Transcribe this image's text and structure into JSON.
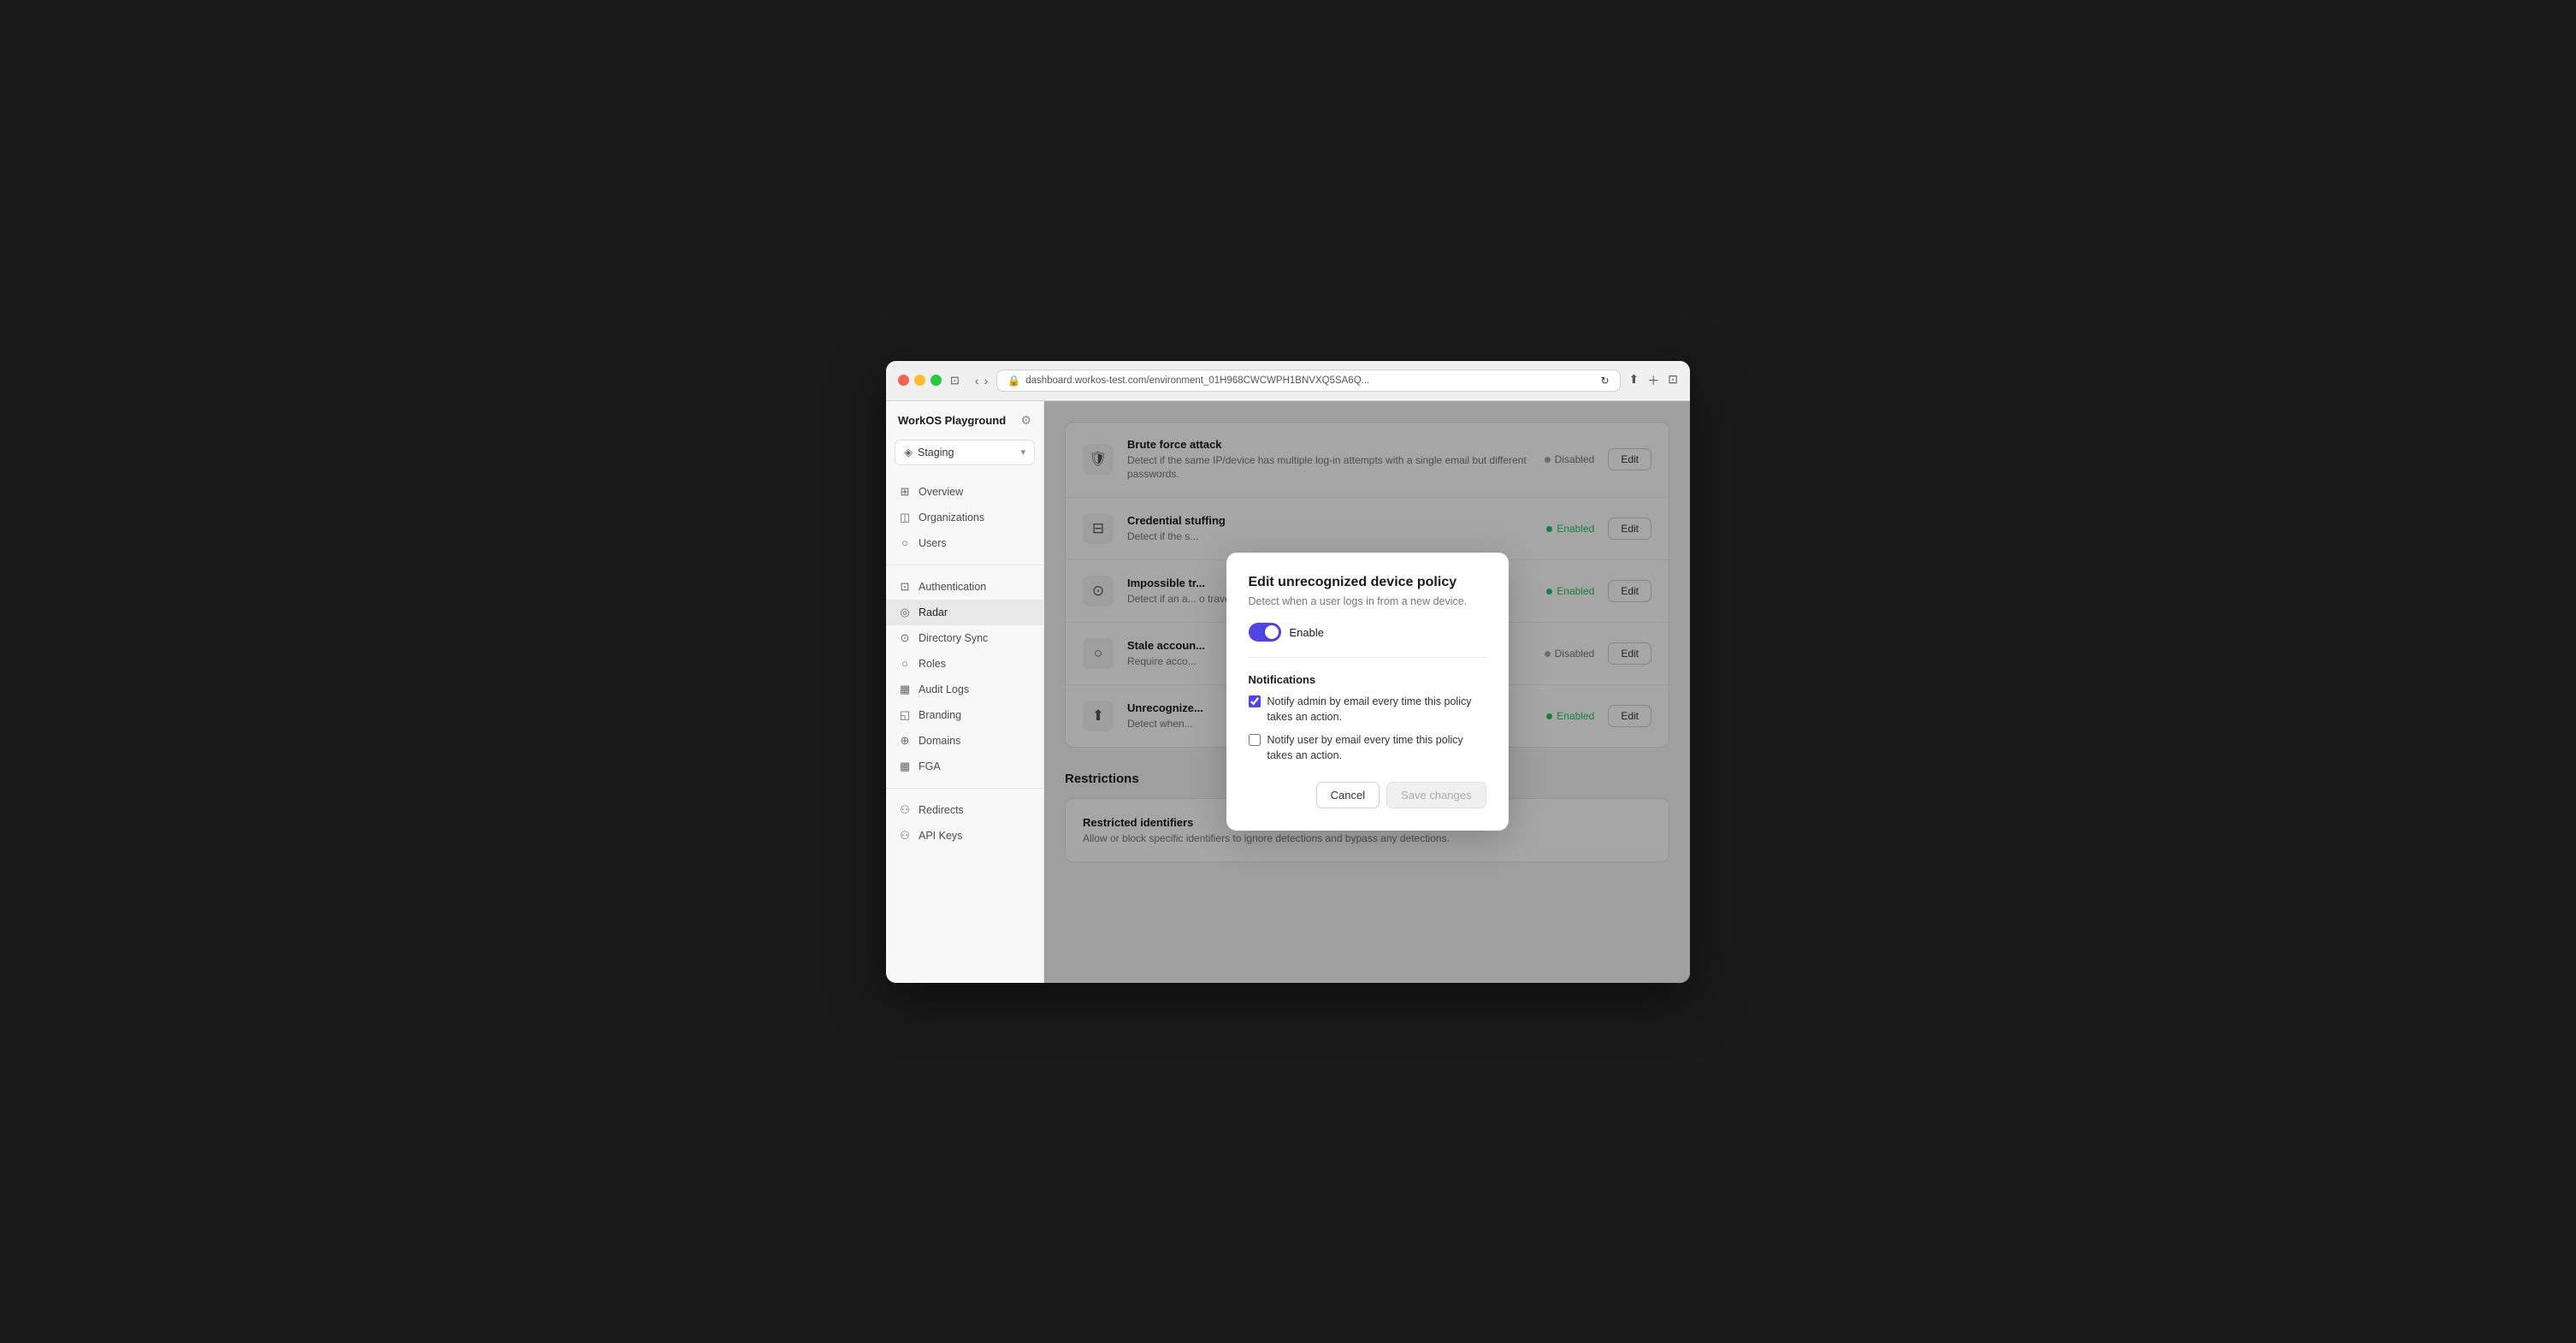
{
  "browser": {
    "url": "dashboard.workos-test.com/environment_01H968CWCWPH1BNVXQ5SA6Q...",
    "back": "‹",
    "forward": "›"
  },
  "app": {
    "title": "WorkOS Playground",
    "environment": "Staging",
    "nav": [
      {
        "id": "overview",
        "label": "Overview",
        "icon": "⊞"
      },
      {
        "id": "organizations",
        "label": "Organizations",
        "icon": "◫"
      },
      {
        "id": "users",
        "label": "Users",
        "icon": "○"
      },
      {
        "id": "authentication",
        "label": "Authentication",
        "icon": "⊡"
      },
      {
        "id": "radar",
        "label": "Radar",
        "icon": "◎",
        "active": true
      },
      {
        "id": "directory-sync",
        "label": "Directory Sync",
        "icon": "⊙"
      },
      {
        "id": "roles",
        "label": "Roles",
        "icon": "○"
      },
      {
        "id": "audit-logs",
        "label": "Audit Logs",
        "icon": "▦"
      },
      {
        "id": "branding",
        "label": "Branding",
        "icon": "◱"
      },
      {
        "id": "domains",
        "label": "Domains",
        "icon": "⊕"
      },
      {
        "id": "fga",
        "label": "FGA",
        "icon": "▦"
      }
    ],
    "bottom_nav": [
      {
        "id": "redirects",
        "label": "Redirects",
        "icon": "⚇"
      },
      {
        "id": "api-keys",
        "label": "API Keys",
        "icon": "⚇"
      }
    ]
  },
  "policies": [
    {
      "id": "brute-force",
      "name": "Brute force attack",
      "desc": "Detect if the same IP/device has multiple log-in attempts with a single email but different passwords.",
      "status": "Disabled",
      "enabled": false,
      "icon": "🛡"
    },
    {
      "id": "credential-stuffing",
      "name": "Credential stuffing",
      "desc": "Detect if the s...",
      "full_desc": "Detect if the same credentials are used across multiple accounts.",
      "status": "Enabled",
      "enabled": true,
      "icon": "⊟"
    },
    {
      "id": "impossible-travel",
      "name": "Impossible travel",
      "desc": "Detect if an a...",
      "full_desc": "Detect if an account logs in from two locations too far apart to travel that fast.",
      "status": "Enabled",
      "enabled": true,
      "icon": "⊙"
    },
    {
      "id": "stale-account",
      "name": "Stale account",
      "desc": "Require acco...",
      "full_desc": "Require account activity to maintain active status.",
      "status": "Disabled",
      "enabled": false,
      "icon": "○"
    },
    {
      "id": "unrecognized-device",
      "name": "Unrecognize...",
      "desc": "Detect when...",
      "full_desc": "Detect when a user logs in from a new device.",
      "status": "Enabled",
      "enabled": true,
      "icon": "⬆"
    }
  ],
  "restrictions": {
    "section_title": "Restrictions",
    "card_title": "Restricted identifiers",
    "card_desc": "Allow or block specific identifiers to ignore detections and bypass any detections."
  },
  "modal": {
    "title": "Edit unrecognized device policy",
    "subtitle": "Detect when a user logs in from a new device.",
    "toggle_label": "Enable",
    "toggle_enabled": true,
    "notifications_title": "Notifications",
    "checkbox1_label": "Notify admin by email every time this policy takes an action.",
    "checkbox1_checked": true,
    "checkbox2_label": "Notify user by email every time this policy takes an action.",
    "checkbox2_checked": false,
    "cancel_label": "Cancel",
    "save_label": "Save changes"
  }
}
